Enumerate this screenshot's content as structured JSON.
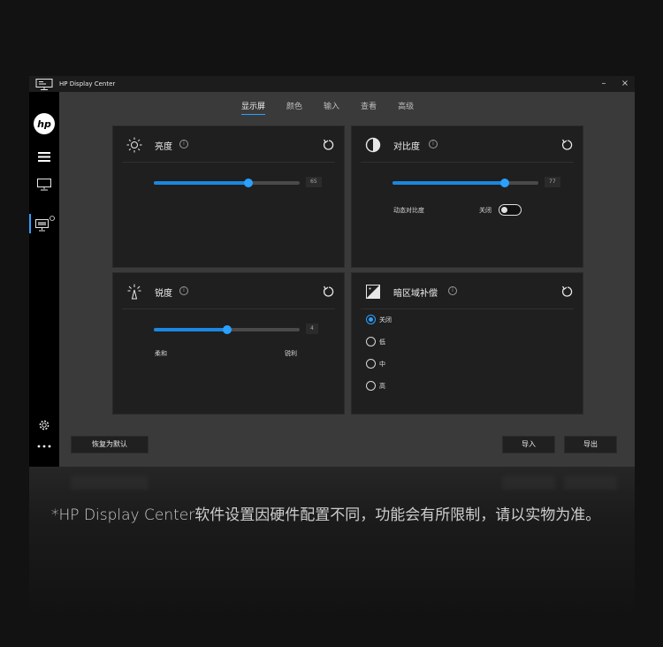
{
  "window": {
    "title": "HP Display Center",
    "minimize": "–",
    "close": "×"
  },
  "sidebar": {
    "logo": "hp",
    "icons": [
      "hp-logo-icon",
      "hamburger-icon",
      "monitor-icon",
      "monitor-settings-icon",
      "gear-icon",
      "more-icon"
    ]
  },
  "tabs": [
    {
      "label": "显示屏",
      "active": true
    },
    {
      "label": "颜色",
      "active": false
    },
    {
      "label": "输入",
      "active": false
    },
    {
      "label": "查看",
      "active": false
    },
    {
      "label": "高级",
      "active": false
    }
  ],
  "brightness": {
    "title": "亮度",
    "value": "65",
    "level": 0.65,
    "info": "i"
  },
  "contrast": {
    "title": "对比度",
    "value": "77",
    "level": 0.77,
    "info": "i",
    "dynamic_label": "动态对比度",
    "dynamic_state": "关闭"
  },
  "sharpness": {
    "title": "锐度",
    "value": "4",
    "level": 0.5,
    "info": "i",
    "min_label": "柔和",
    "max_label": "锐利"
  },
  "dark_boost": {
    "title": "暗区域补偿",
    "info": "i",
    "options": [
      "关闭",
      "低",
      "中",
      "高"
    ],
    "selected": "关闭"
  },
  "buttons": {
    "restore": "恢复为默认",
    "import": "导入",
    "export": "导出"
  },
  "footnote": "*HP Display Center软件设置因硬件配置不同，功能会有所限制，请以实物为准。",
  "colors": {
    "accent": "#2aa0ff",
    "panel": "#1f1f1f",
    "window": "#3a3a3a"
  }
}
